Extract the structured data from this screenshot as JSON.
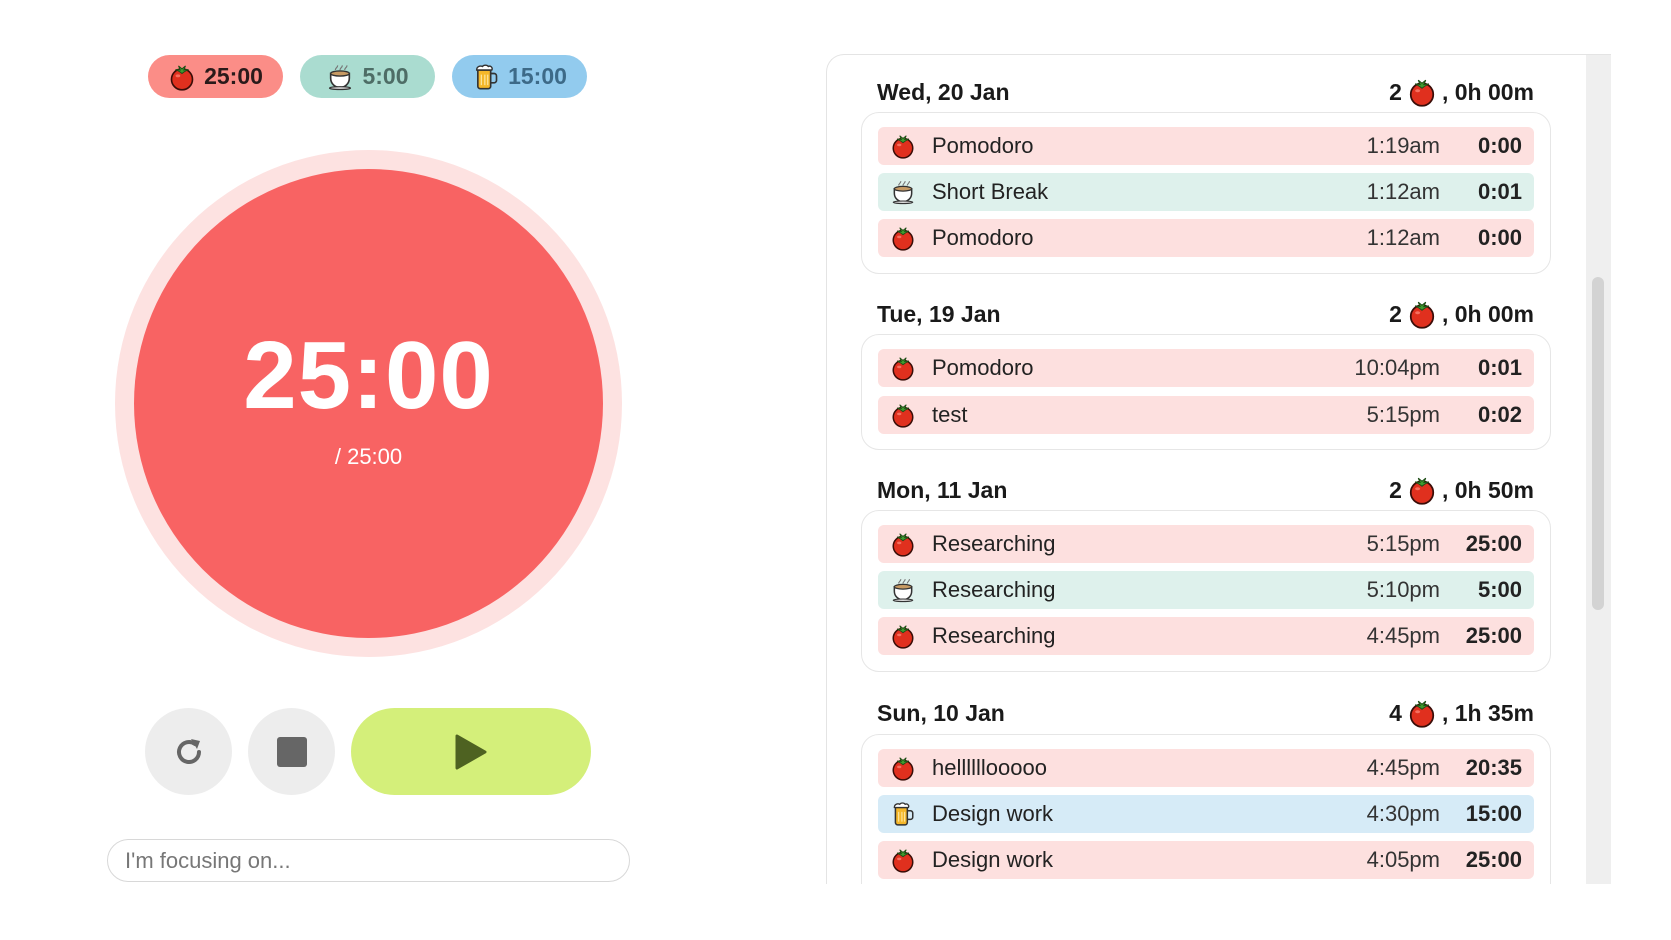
{
  "presets": [
    {
      "kind": "pomodoro",
      "icon": "tomato-icon",
      "label": "25:00"
    },
    {
      "kind": "short-break",
      "icon": "coffee-cup-icon",
      "label": "5:00"
    },
    {
      "kind": "long-break",
      "icon": "beer-mug-icon",
      "label": "15:00"
    }
  ],
  "timer": {
    "remaining": "25:00",
    "total": "/ 25:00"
  },
  "controls": {
    "restart_icon": "restart-icon",
    "stop_icon": "stop-icon",
    "play_icon": "play-icon"
  },
  "focus": {
    "placeholder": "I'm focusing on..."
  },
  "colors": {
    "pomodoro": "#f86363",
    "pomodoro_light": "#fde0df",
    "short_break": "#aadcd0",
    "long_break": "#92cbee",
    "play": "#d4ef7a"
  },
  "history": {
    "days": [
      {
        "date": "Wed, 20 Jan",
        "count": "2",
        "duration": ", 0h 00m",
        "entries": [
          {
            "type": "pomo",
            "name": "Pomodoro",
            "start": "1:19am",
            "duration": "0:00"
          },
          {
            "type": "short",
            "name": "Short Break",
            "start": "1:12am",
            "duration": "0:01"
          },
          {
            "type": "pomo",
            "name": "Pomodoro",
            "start": "1:12am",
            "duration": "0:00"
          }
        ]
      },
      {
        "date": "Tue, 19 Jan",
        "count": "2",
        "duration": ", 0h 00m",
        "entries": [
          {
            "type": "pomo",
            "name": "Pomodoro",
            "start": "10:04pm",
            "duration": "0:01"
          },
          {
            "type": "pomo",
            "name": "test",
            "start": "5:15pm",
            "duration": "0:02"
          }
        ]
      },
      {
        "date": "Mon, 11 Jan",
        "count": "2",
        "duration": ", 0h 50m",
        "entries": [
          {
            "type": "pomo",
            "name": "Researching",
            "start": "5:15pm",
            "duration": "25:00"
          },
          {
            "type": "short",
            "name": "Researching",
            "start": "5:10pm",
            "duration": "5:00"
          },
          {
            "type": "pomo",
            "name": "Researching",
            "start": "4:45pm",
            "duration": "25:00"
          }
        ]
      },
      {
        "date": "Sun, 10 Jan",
        "count": "4",
        "duration": ", 1h 35m",
        "entries": [
          {
            "type": "pomo",
            "name": "hellllllooooo",
            "start": "4:45pm",
            "duration": "20:35"
          },
          {
            "type": "long",
            "name": "Design work",
            "start": "4:30pm",
            "duration": "15:00"
          },
          {
            "type": "pomo",
            "name": "Design work",
            "start": "4:05pm",
            "duration": "25:00"
          }
        ]
      }
    ]
  }
}
